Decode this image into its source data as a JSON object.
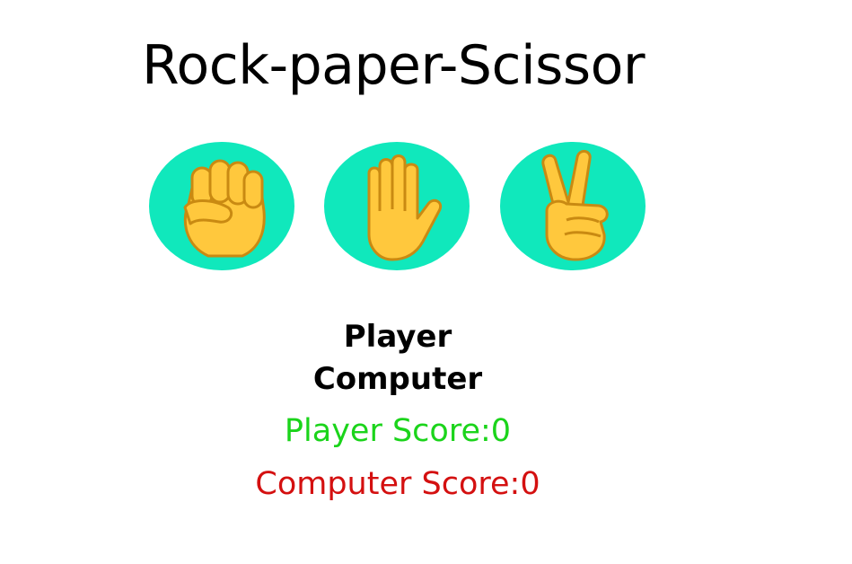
{
  "title": "Rock-paper-Scissor",
  "choices": [
    {
      "name": "rock",
      "icon": "raised-fist-icon"
    },
    {
      "name": "paper",
      "icon": "raised-hand-icon"
    },
    {
      "name": "scissors",
      "icon": "victory-hand-icon"
    }
  ],
  "labels": {
    "player": "Player",
    "computer": "Computer"
  },
  "scores": {
    "player": "Player Score:0",
    "computer": "Computer Score:0"
  },
  "colors": {
    "choice_bg": "#10e8bc",
    "hand": "#ffc83d",
    "hand_outline": "#c98a12",
    "player_score": "#1bd41b",
    "computer_score": "#d41010"
  }
}
